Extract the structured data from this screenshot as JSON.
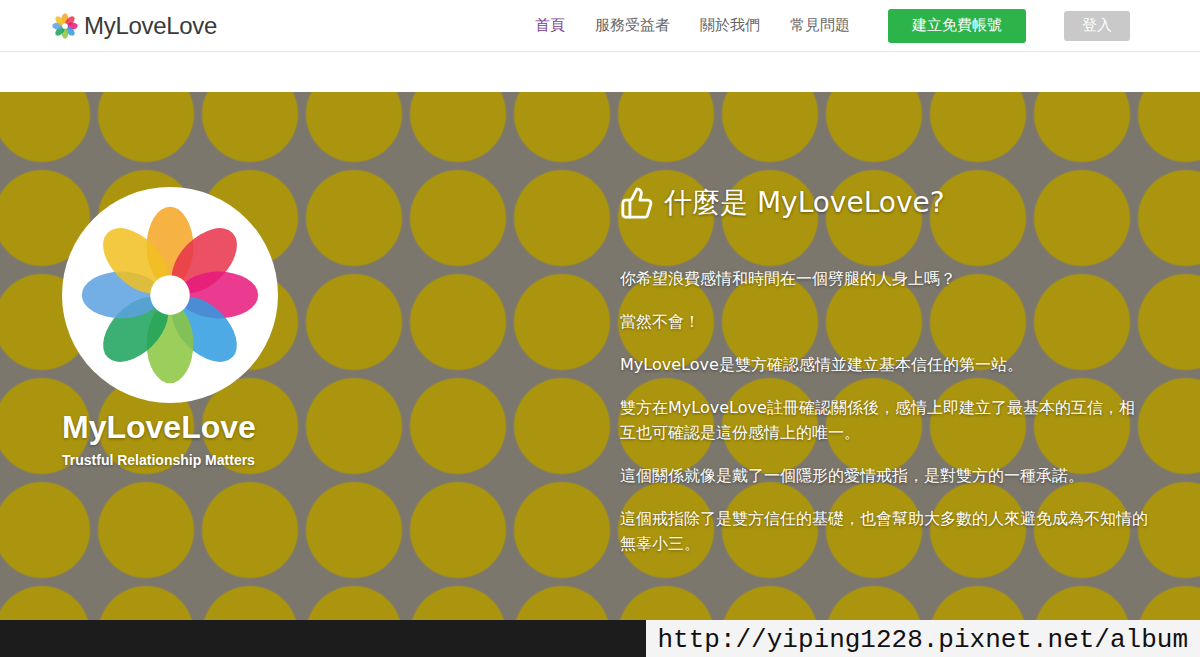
{
  "brand": {
    "name": "MyLoveLove"
  },
  "nav": {
    "items": [
      {
        "label": "首頁",
        "selected": true
      },
      {
        "label": "服務受益者",
        "selected": false
      },
      {
        "label": "關於我們",
        "selected": false
      },
      {
        "label": "常見問題",
        "selected": false
      }
    ],
    "signup": "建立免費帳號",
    "login": "登入"
  },
  "hero": {
    "logo_title": "MyLoveLove",
    "logo_tagline": "Trustful Relationship Matters",
    "heading": "什麼是 MyLoveLove?",
    "paragraphs": [
      "你希望浪費感情和時間在一個劈腿的人身上嗎？",
      "當然不會！",
      "MyLoveLove是雙方確認感情並建立基本信任的第一站。",
      "雙方在MyLoveLove註冊確認關係後，感情上即建立了最基本的互信，相互也可確認是這份感情上的唯一。",
      "這個關係就像是戴了一個隱形的愛情戒指，是對雙方的一種承諾。",
      "這個戒指除了是雙方信任的基礎，也會幫助大多數的人來避免成為不知情的無辜小三。"
    ]
  },
  "watermark": "http://yiping1228.pixnet.net/album"
}
